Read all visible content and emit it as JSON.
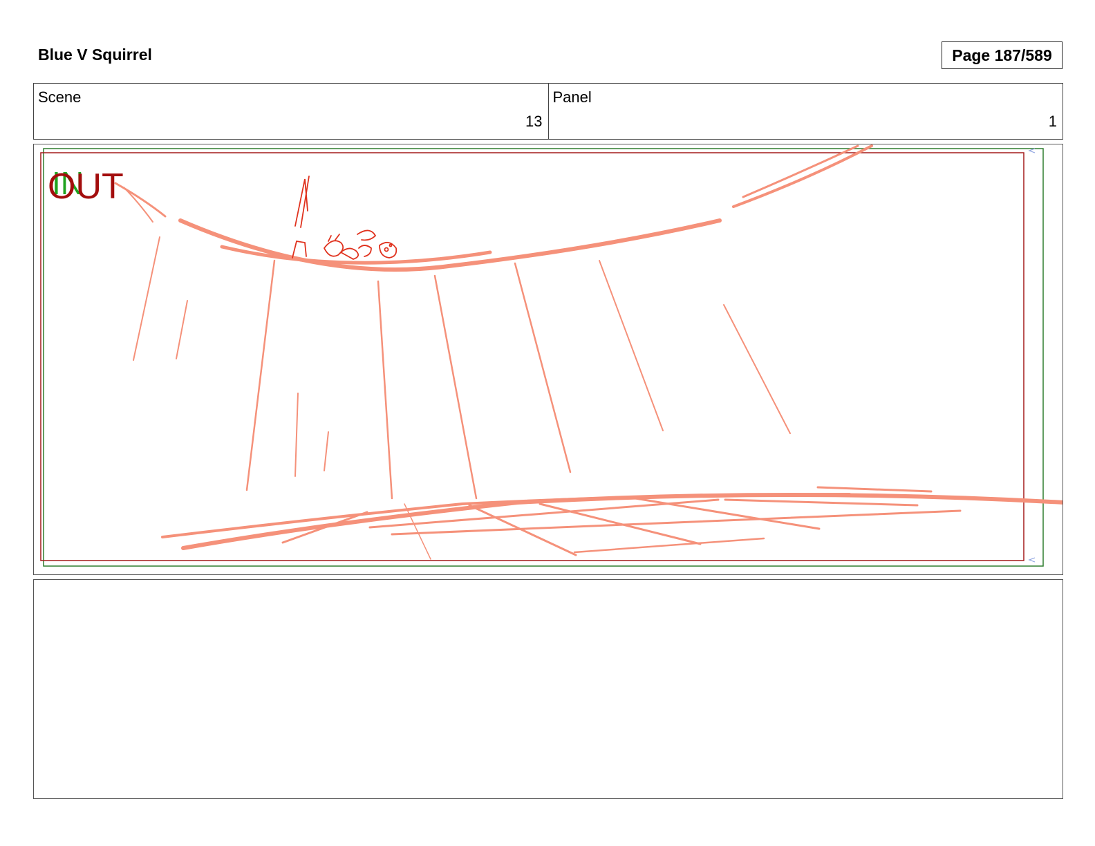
{
  "header": {
    "project_title": "Blue V Squirrel",
    "page_label": "Page 187/589"
  },
  "info": {
    "scene_label": "Scene",
    "scene_value": "13",
    "panel_label": "Panel",
    "panel_value": "1"
  },
  "frame": {
    "in_marker": "IN",
    "out_marker": "OUT",
    "colors": {
      "in": "#1fa31f",
      "out": "#a30d0d",
      "sketch": "#f5917a",
      "sketch_dark": "#e0321e",
      "outer_border": "#2e7d2e",
      "inner_border": "#a31a1a"
    }
  },
  "notes": {
    "text": ""
  }
}
